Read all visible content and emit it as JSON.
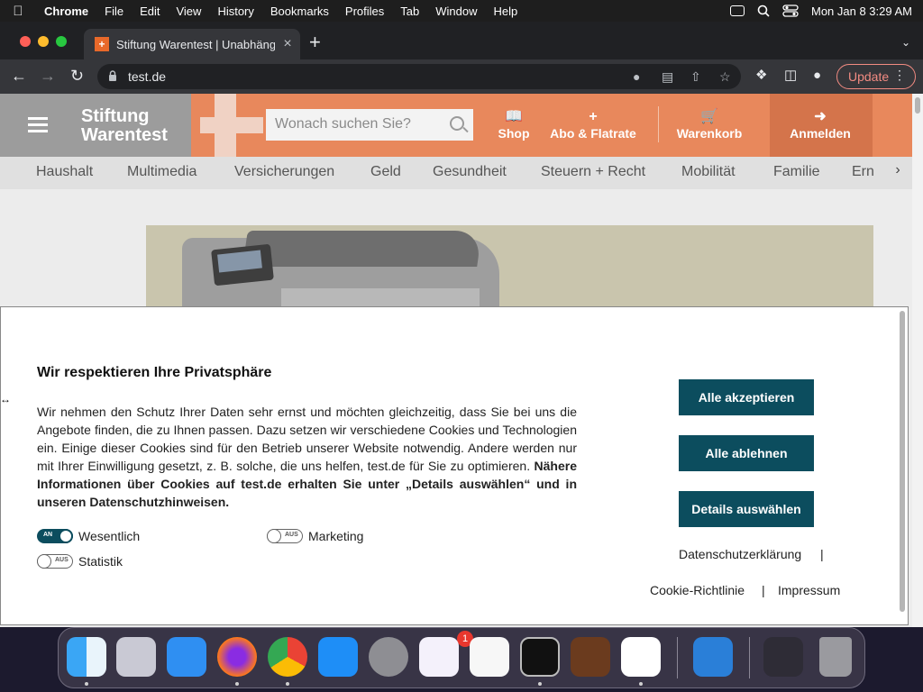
{
  "menubar": {
    "apple": "",
    "items": [
      "Chrome",
      "File",
      "Edit",
      "View",
      "History",
      "Bookmarks",
      "Profiles",
      "Tab",
      "Window",
      "Help"
    ],
    "clock": "Mon Jan 8  3:29 AM"
  },
  "browser": {
    "tab_title": "Stiftung Warentest | Unabhäng",
    "tab_close": "×",
    "new_tab": "+",
    "url": "test.de",
    "update_label": "Update"
  },
  "site": {
    "brand_line1": "Stiftung",
    "brand_line2": "Warentest",
    "search_placeholder": "Wonach suchen Sie?",
    "nav": {
      "shop": "Shop",
      "abo": "Abo & Flatrate",
      "warenkorb": "Warenkorb",
      "anmelden": "Anmelden"
    },
    "categories": [
      "Haushalt",
      "Multimedia",
      "Versicherungen",
      "Geld",
      "Gesundheit",
      "Steuern + Recht",
      "Mobilität",
      "Familie",
      "Ern"
    ]
  },
  "cookie": {
    "title": "Wir respektieren Ihre Privatsphäre",
    "body": "Wir nehmen den Schutz Ihrer Daten sehr ernst und möchten gleichzeitig, dass Sie bei uns die Angebote finden, die zu Ihnen passen. Dazu setzen wir verschiedene Cookies und Technologien ein. Einige dieser Cookies sind für den Betrieb unserer Website notwendig. Andere werden nur mit Ihrer Einwilligung gesetzt, z. B. solche, die uns helfen, test.de für Sie zu optimieren. ",
    "body_bold": "Nähere Informationen über Cookies auf test.de erhalten Sie unter „Details auswählen“ und in unseren Datenschutzhinweisen.",
    "toggles": [
      {
        "label": "Wesentlich",
        "state": "AN",
        "on": true
      },
      {
        "label": "Marketing",
        "state": "AUS",
        "on": false
      },
      {
        "label": "Statistik",
        "state": "AUS",
        "on": false
      }
    ],
    "accept_all": "Alle akzeptieren",
    "reject_all": "Alle ablehnen",
    "details": "Details auswählen",
    "privacy_link": "Datenschutzerklärung",
    "cookie_policy_link": "Cookie-Richtlinie",
    "imprint_link": "Impressum",
    "separator": "|"
  },
  "dock": {
    "notification_badge": "1",
    "apps": [
      "Finder",
      "Launchpad",
      "Safari",
      "Firefox",
      "Chrome",
      "App Store",
      "System Preferences",
      "Visual Studio",
      "TextEdit",
      "Terminal",
      "GarageBand",
      "VS Code",
      "Weather",
      "Screenshot",
      "Trash"
    ]
  },
  "colors": {
    "brand_orange": "#e8885c",
    "cookie_button": "#0c4d5e"
  }
}
